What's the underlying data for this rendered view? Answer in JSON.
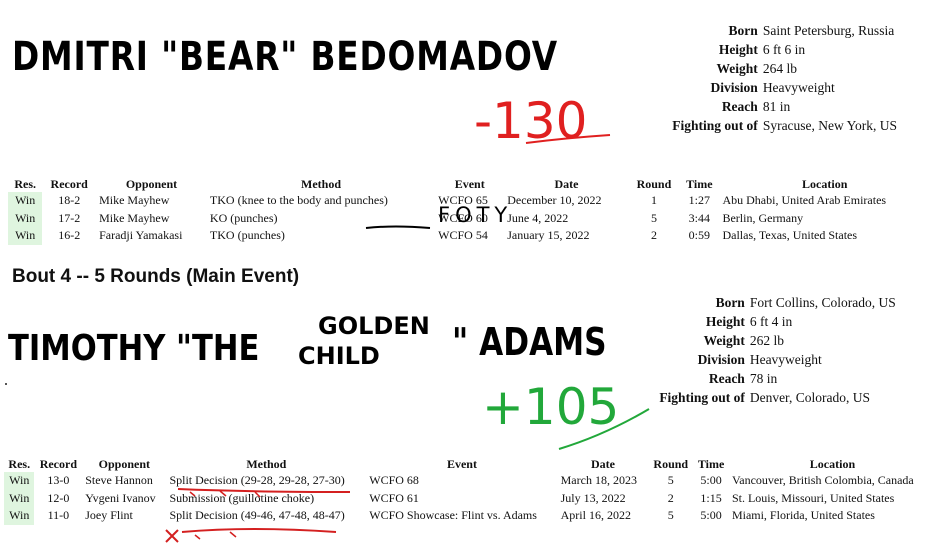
{
  "fighter1": {
    "name": "Dmitri \"Bear\" Bedomadov",
    "odds": "-130",
    "odds_color": "#e02020",
    "info_labels": [
      "Born",
      "Height",
      "Weight",
      "Division",
      "Reach",
      "Fighting out of"
    ],
    "info_values": [
      "Saint Petersburg, Russia",
      "6 ft 6 in",
      "264 lb",
      "Heavyweight",
      "81 in",
      "Syracuse, New York, US"
    ],
    "annotation": "FOTY",
    "record": [
      {
        "res": "Win",
        "record": "18-2",
        "opponent": "Mike Mayhew",
        "method": "TKO (knee to the body and punches)",
        "event": "WCFO 65",
        "date": "December 10, 2022",
        "round": "1",
        "time": "1:27",
        "location": "Abu Dhabi, United Arab Emirates"
      },
      {
        "res": "Win",
        "record": "17-2",
        "opponent": "Mike Mayhew",
        "method": "KO (punches)",
        "event": "WCFO 60",
        "date": "June 4, 2022",
        "round": "5",
        "time": "3:44",
        "location": "Berlin, Germany"
      },
      {
        "res": "Win",
        "record": "16-2",
        "opponent": "Faradji Yamakasi",
        "method": "TKO (punches)",
        "event": "WCFO 54",
        "date": "January 15, 2022",
        "round": "2",
        "time": "0:59",
        "location": "Dallas, Texas, United States"
      }
    ]
  },
  "bout_title": "Bout 4 -- 5 Rounds (Main Event)",
  "fighter2": {
    "name_line1": "Timothy \"the",
    "nickname_line1": "Golden",
    "nickname_line2": "Child",
    "name_line2": "\" Adams",
    "odds": "+105",
    "odds_color": "#22a83a",
    "info_labels": [
      "Born",
      "Height",
      "Weight",
      "Division",
      "Reach",
      "Fighting out of"
    ],
    "info_values": [
      "Fort Collins, Colorado, US",
      "6 ft 4 in",
      "262 lb",
      "Heavyweight",
      "78 in",
      "Denver, Colorado, US"
    ],
    "record": [
      {
        "res": "Win",
        "record": "13-0",
        "opponent": "Steve Hannon",
        "method": "Split Decision (29-28, 29-28, 27-30)",
        "event": "WCFO 68",
        "date": "March 18, 2023",
        "round": "5",
        "time": "5:00",
        "location": "Vancouver, British Colombia, Canada"
      },
      {
        "res": "Win",
        "record": "12-0",
        "opponent": "Yvgeni Ivanov",
        "method": "Submission (guillotine choke)",
        "event": "WCFO 61",
        "date": "July 13, 2022",
        "round": "2",
        "time": "1:15",
        "location": "St. Louis, Missouri, United States"
      },
      {
        "res": "Win",
        "record": "11-0",
        "opponent": "Joey Flint",
        "method": "Split Decision (49-46, 47-48, 48-47)",
        "event": "WCFO Showcase: Flint vs. Adams",
        "date": "April 16, 2022",
        "round": "5",
        "time": "5:00",
        "location": "Miami, Florida, United States"
      }
    ]
  },
  "record_headers": [
    "Res.",
    "Record",
    "Opponent",
    "Method",
    "Event",
    "Date",
    "Round",
    "Time",
    "Location"
  ],
  "markup_color": "#d42020"
}
